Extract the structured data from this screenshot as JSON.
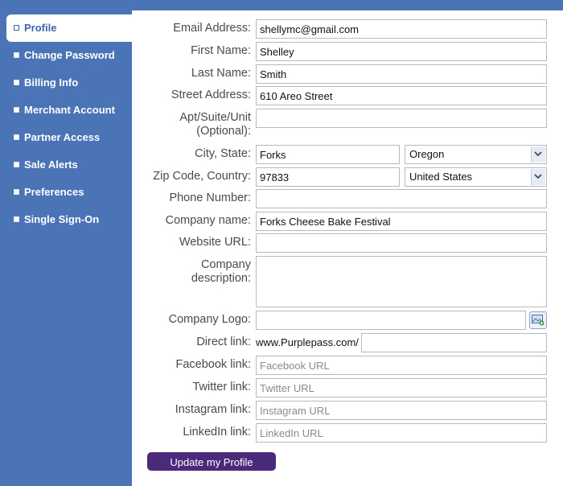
{
  "sidebar": {
    "items": [
      {
        "label": "Profile"
      },
      {
        "label": "Change Password"
      },
      {
        "label": "Billing Info"
      },
      {
        "label": "Merchant Account"
      },
      {
        "label": "Partner Access"
      },
      {
        "label": "Sale Alerts"
      },
      {
        "label": "Preferences"
      },
      {
        "label": "Single Sign-On"
      }
    ],
    "active_item": "Profile"
  },
  "form": {
    "email": {
      "label": "Email Address:",
      "value": "shellymc@gmail.com"
    },
    "first_name": {
      "label": "First Name:",
      "value": "Shelley"
    },
    "last_name": {
      "label": "Last Name:",
      "value": "Smith"
    },
    "street": {
      "label": "Street Address:",
      "value": "610 Areo Street"
    },
    "apt": {
      "label_line1": "Apt/Suite/Unit",
      "label_line2": "(Optional):",
      "value": ""
    },
    "city_state": {
      "label": "City, State:",
      "city": "Forks",
      "state": "Oregon"
    },
    "zip_country": {
      "label": "Zip Code, Country:",
      "zip": "97833",
      "country": "United States"
    },
    "phone": {
      "label": "Phone Number:",
      "value": ""
    },
    "company_name": {
      "label": "Company name:",
      "value": "Forks Cheese Bake Festival"
    },
    "website": {
      "label": "Website URL:",
      "value": ""
    },
    "company_description": {
      "label_line1": "Company",
      "label_line2": "description:",
      "value": ""
    },
    "company_logo": {
      "label": "Company Logo:",
      "value": ""
    },
    "direct_link": {
      "label": "Direct link:",
      "prefix": "www.Purplepass.com/",
      "value": ""
    },
    "facebook": {
      "label": "Facebook link:",
      "placeholder": "Facebook URL"
    },
    "twitter": {
      "label": "Twitter link:",
      "placeholder": "Twitter URL"
    },
    "instagram": {
      "label": "Instagram link:",
      "placeholder": "Instagram URL"
    },
    "linkedin": {
      "label": "LinkedIn link:",
      "placeholder": "LinkedIn URL"
    },
    "submit_label": "Update my Profile"
  },
  "colors": {
    "sidebar_bg": "#4a74b5",
    "active_text": "#3a66ad",
    "submit_bg": "#4b2a7c"
  }
}
